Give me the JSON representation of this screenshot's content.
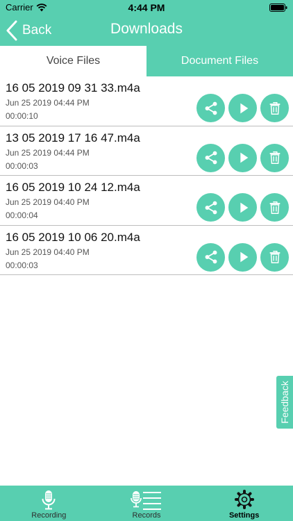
{
  "status_bar": {
    "carrier": "Carrier",
    "time": "4:44 PM"
  },
  "nav": {
    "back_label": "Back",
    "title": "Downloads"
  },
  "tabs": [
    {
      "label": "Voice Files",
      "active": true
    },
    {
      "label": "Document Files",
      "active": false
    }
  ],
  "files": [
    {
      "name": "16 05 2019 09 31 33.m4a",
      "date": "Jun 25 2019 04:44 PM",
      "duration": "00:00:10"
    },
    {
      "name": "13 05 2019 17 16 47.m4a",
      "date": "Jun 25 2019 04:44 PM",
      "duration": "00:00:03"
    },
    {
      "name": "16 05 2019 10 24 12.m4a",
      "date": "Jun 25 2019 04:40 PM",
      "duration": "00:00:04"
    },
    {
      "name": "16 05 2019 10 06 20.m4a",
      "date": "Jun 25 2019 04:40 PM",
      "duration": "00:00:03"
    }
  ],
  "row_actions": [
    "share-icon",
    "play-icon",
    "trash-icon"
  ],
  "feedback": {
    "label": "Feedback"
  },
  "bottom_bar": [
    {
      "label": "Recording",
      "icon": "microphone-icon"
    },
    {
      "label": "Records",
      "icon": "records-list-icon"
    },
    {
      "label": "Settings",
      "icon": "gear-icon",
      "selected": true
    }
  ],
  "colors": {
    "accent": "#58cfb0",
    "separator": "#bdbdbd"
  }
}
